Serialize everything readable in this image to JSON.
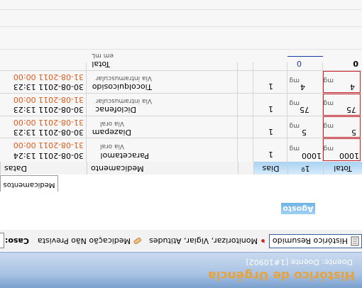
{
  "header": {
    "title": "Histórico de Urgência",
    "subtitle": "Doente: Doente [1#10902]"
  },
  "toolbar": {
    "historico_label": "Histórico Resumido",
    "monitorizar_label": "Monitorizar, Vigiar, Atitudes",
    "medicacao_label": "Medicação Não Prevista",
    "caso_label": "Caso:"
  },
  "month_label": "Agosto",
  "tab_label": "Medicamentos",
  "table": {
    "headers": {
      "datas": "Datas",
      "medicamento": "Medicamento",
      "dias": "Dias",
      "first": "1º",
      "total": "Total"
    },
    "rows": [
      {
        "date1": "30-08-2011 13:24",
        "date2": "31-08-2011 00:00",
        "drug": "Paracetamol",
        "route": "Via oral",
        "dias": "1",
        "first": "1000",
        "unit1": "mg",
        "total": "1000",
        "unit2": "mg"
      },
      {
        "date1": "30-08-2011 13:23",
        "date2": "31-08-2011 00:00",
        "drug": "Diazepam",
        "route": "Via oral",
        "dias": "1",
        "first": "5",
        "unit1": "mg",
        "total": "5",
        "unit2": "mg"
      },
      {
        "date1": "30-08-2011 13:23",
        "date2": "31-08-2011 00:00",
        "drug": "Diclofenac",
        "route": "Via intramuscular",
        "dias": "1",
        "first": "75",
        "unit1": "mg",
        "total": "75",
        "unit2": "mg"
      },
      {
        "date1": "30-08-2011 13:23",
        "date2": "31-08-2011 00:00",
        "drug": "Tiocolquicosido",
        "route": "Via intramuscular",
        "dias": "1",
        "first": "4",
        "unit1": "mg",
        "total": "4",
        "unit2": "mg"
      }
    ],
    "total_row": {
      "label": "Total",
      "unit": "em mL",
      "first": "0",
      "total": "0"
    }
  },
  "colors": {
    "accent_orange": "#e8a23a",
    "date_orange": "#e05a1a",
    "selection_red": "#c8202a",
    "header_blue": "#a9d2f2"
  }
}
